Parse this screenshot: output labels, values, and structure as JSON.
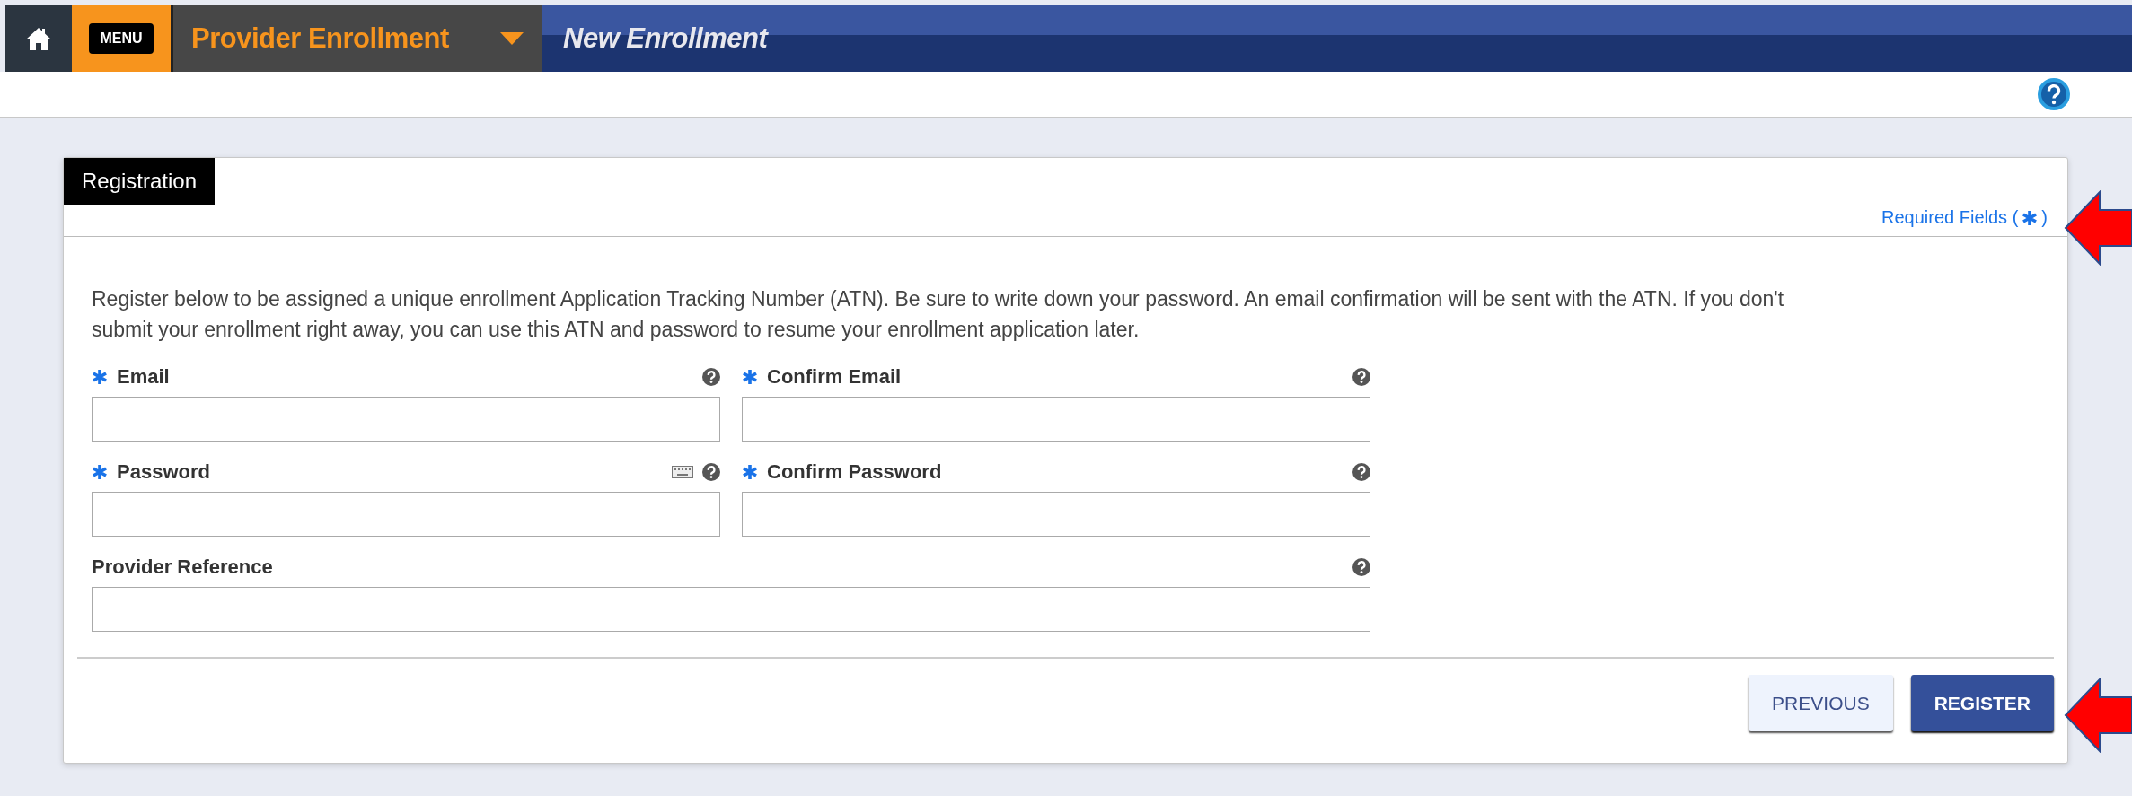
{
  "header": {
    "menu_label": "MENU",
    "module": "Provider Enrollment",
    "page_title": "New Enrollment"
  },
  "form": {
    "tab": {
      "label": "Registration",
      "selected": true
    },
    "required_note": {
      "text": "Required Fields (",
      "close": ")"
    },
    "intro": "Register below to be assigned a unique enrollment Application Tracking Number (ATN). Be sure to write down your password. An email confirmation will be sent with the ATN. If you don't submit your enrollment right away, you can use this ATN and password to resume your enrollment application later.",
    "fields": [
      {
        "label": "Email",
        "required": true,
        "keyboard": false,
        "wide": false
      },
      {
        "label": "Confirm Email",
        "required": true,
        "keyboard": false,
        "wide": false
      },
      {
        "label": "Password",
        "required": true,
        "keyboard": true,
        "wide": false
      },
      {
        "label": "Confirm Password",
        "required": true,
        "keyboard": false,
        "wide": false
      },
      {
        "label": "Provider Reference",
        "required": false,
        "keyboard": false,
        "wide": true
      }
    ],
    "buttons": [
      {
        "label": "PREVIOUS",
        "kind": "secondary"
      },
      {
        "label": "REGISTER",
        "kind": "primary"
      }
    ]
  }
}
